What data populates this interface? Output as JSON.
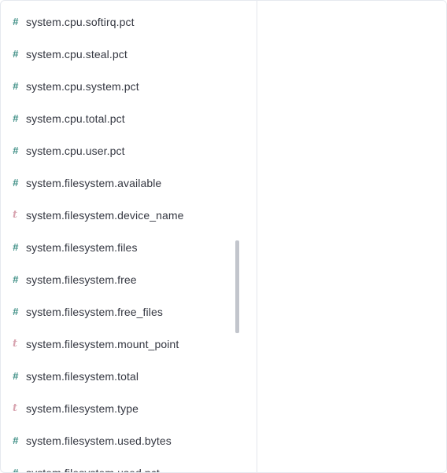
{
  "fields": [
    {
      "type": "number",
      "icon": "#",
      "name": "system.cpu.softirq.pct"
    },
    {
      "type": "number",
      "icon": "#",
      "name": "system.cpu.steal.pct"
    },
    {
      "type": "number",
      "icon": "#",
      "name": "system.cpu.system.pct"
    },
    {
      "type": "number",
      "icon": "#",
      "name": "system.cpu.total.pct"
    },
    {
      "type": "number",
      "icon": "#",
      "name": "system.cpu.user.pct"
    },
    {
      "type": "number",
      "icon": "#",
      "name": "system.filesystem.available"
    },
    {
      "type": "string",
      "icon": "t",
      "name": "system.filesystem.device_name"
    },
    {
      "type": "number",
      "icon": "#",
      "name": "system.filesystem.files"
    },
    {
      "type": "number",
      "icon": "#",
      "name": "system.filesystem.free"
    },
    {
      "type": "number",
      "icon": "#",
      "name": "system.filesystem.free_files"
    },
    {
      "type": "string",
      "icon": "t",
      "name": "system.filesystem.mount_point"
    },
    {
      "type": "number",
      "icon": "#",
      "name": "system.filesystem.total"
    },
    {
      "type": "string",
      "icon": "t",
      "name": "system.filesystem.type"
    },
    {
      "type": "number",
      "icon": "#",
      "name": "system.filesystem.used.bytes"
    },
    {
      "type": "number",
      "icon": "#",
      "name": "system.filesystem.used.pct"
    }
  ],
  "icons": {
    "number": "number-field-icon",
    "string": "string-field-icon"
  },
  "colors": {
    "number_icon": "#3f8f86",
    "string_icon": "#d8a4b0",
    "text": "#343741",
    "divider": "#e3e6ec",
    "scrollbar": "#c2c5cc"
  }
}
